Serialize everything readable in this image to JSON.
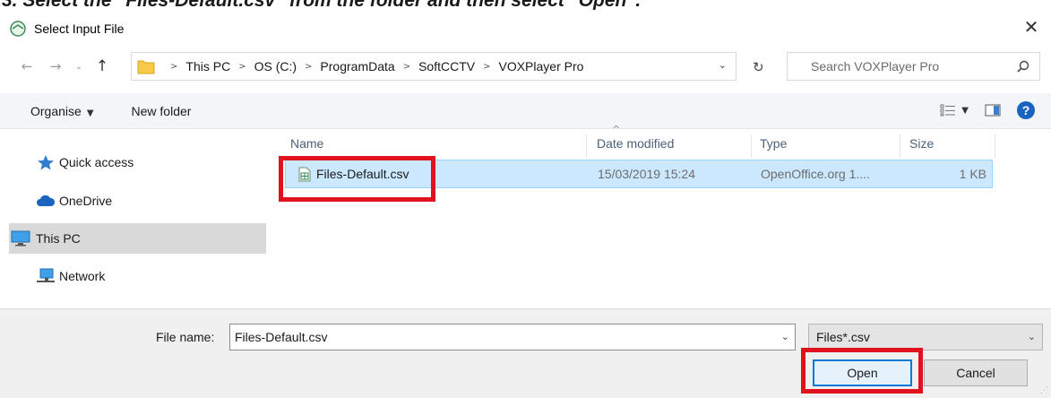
{
  "caption": "3. Select the \"Files-Default.csv\" from the folder and then select \"Open\".",
  "window": {
    "title": "Select Input File",
    "close_glyph": "✕"
  },
  "nav": {
    "breadcrumbs": [
      "This PC",
      "OS (C:)",
      "ProgramData",
      "SoftCCTV",
      "VOXPlayer Pro"
    ],
    "search_placeholder": "Search VOXPlayer Pro"
  },
  "toolbar": {
    "organise_label": "Organise",
    "new_folder_label": "New folder"
  },
  "sidebar": {
    "items": [
      {
        "label": "Quick access",
        "icon": "star-icon"
      },
      {
        "label": "OneDrive",
        "icon": "cloud-icon"
      },
      {
        "label": "This PC",
        "icon": "monitor-icon",
        "selected": true
      },
      {
        "label": "Network",
        "icon": "network-icon"
      }
    ]
  },
  "file_list": {
    "columns": [
      "Name",
      "Date modified",
      "Type",
      "Size"
    ],
    "rows": [
      {
        "name": "Files-Default.csv",
        "date_modified": "15/03/2019 15:24",
        "type": "OpenOffice.org 1....",
        "size": "1 KB",
        "selected": true
      }
    ]
  },
  "footer": {
    "file_name_label": "File name:",
    "file_name_value": "Files-Default.csv",
    "filter_value": "Files*.csv",
    "open_label": "Open",
    "cancel_label": "Cancel"
  },
  "colors": {
    "highlight": "#e0121e",
    "selection": "#cce8ff",
    "accent": "#0078d7"
  }
}
